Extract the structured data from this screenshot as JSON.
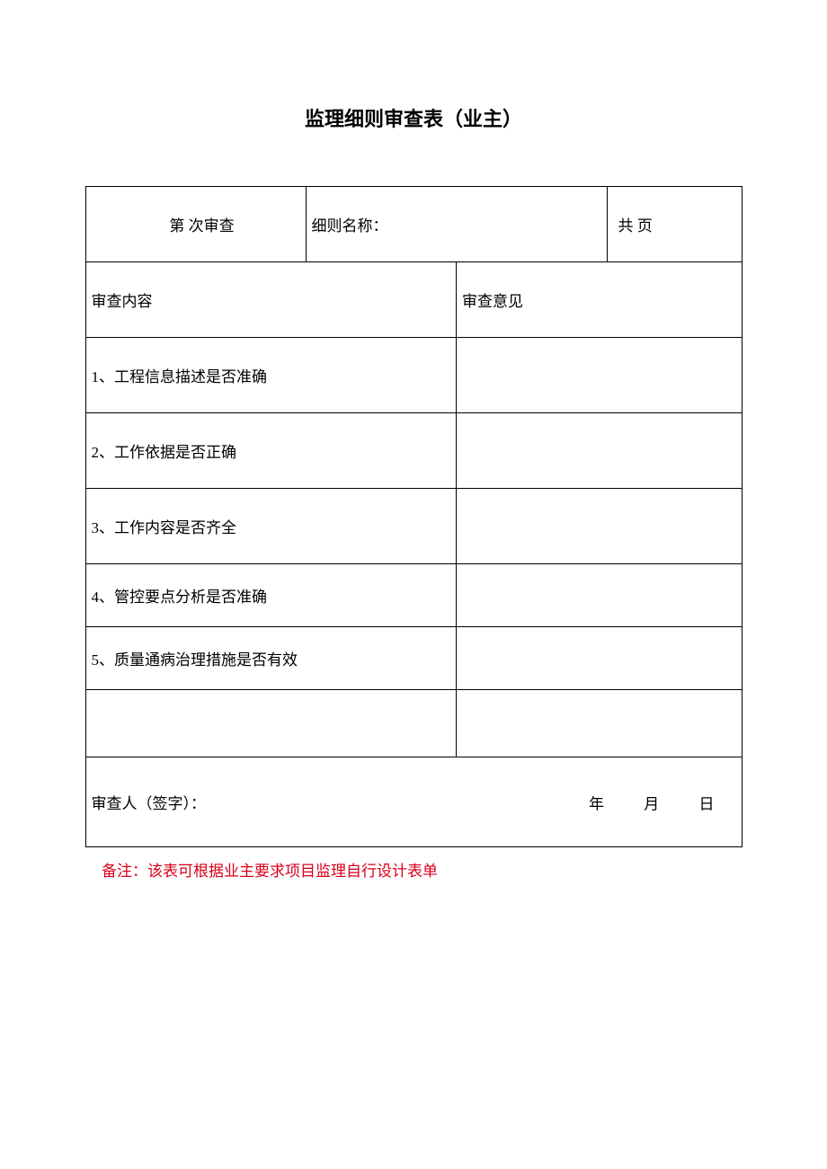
{
  "title": "监理细则审查表（业主）",
  "header": {
    "review_number_label": "第 次审查",
    "rule_name_label": "细则名称：",
    "pages_label": "共 页"
  },
  "columns": {
    "content_label": "审查内容",
    "opinion_label": "审查意见"
  },
  "items": [
    {
      "text": "1、工程信息描述是否准确",
      "opinion": ""
    },
    {
      "text": "2、工作依据是否正确",
      "opinion": ""
    },
    {
      "text": "3、工作内容是否齐全",
      "opinion": ""
    },
    {
      "text": "4、管控要点分析是否准确",
      "opinion": ""
    },
    {
      "text": "5、质量通病治理措施是否有效",
      "opinion": ""
    },
    {
      "text": "",
      "opinion": ""
    }
  ],
  "signature": {
    "label": "审查人（签字）：",
    "year_unit": "年",
    "month_unit": "月",
    "day_unit": "日"
  },
  "note": "备注：该表可根据业主要求项目监理自行设计表单"
}
